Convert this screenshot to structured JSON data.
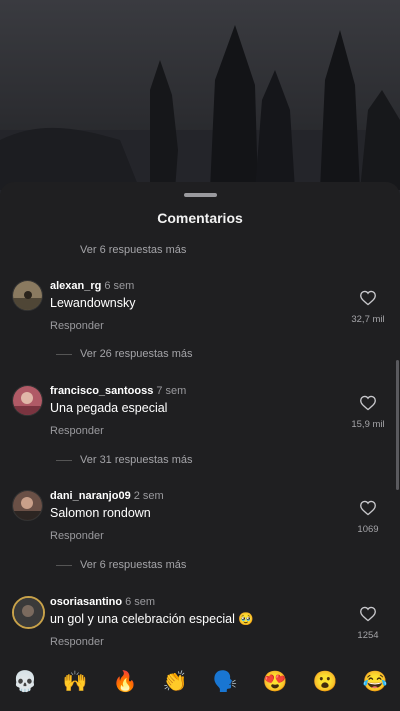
{
  "sheet": {
    "title": "Comentarios"
  },
  "more_replies_top": "Ver 6 respuestas más",
  "comments": [
    {
      "user": "alexan_rg",
      "time": "6 sem",
      "text": "Lewandownsky",
      "reply": "Responder",
      "likes": "32,7 mil",
      "more_replies": "Ver 26 respuestas más",
      "avatar_color": "#8a7a60"
    },
    {
      "user": "francisco_santooss",
      "time": "7 sem",
      "text": "Una pegada especial",
      "reply": "Responder",
      "likes": "15,9 mil",
      "more_replies": "Ver 31 respuestas más",
      "avatar_color": "#b05a66"
    },
    {
      "user": "dani_naranjo09",
      "time": "2 sem",
      "text": "Salomon rondown",
      "reply": "Responder",
      "likes": "1069",
      "more_replies": "Ver 6 respuestas más",
      "avatar_color": "#6a5046"
    },
    {
      "user": "osoriasantino",
      "time": "6 sem",
      "text": "un gol y una celebración especial 🥹",
      "reply": "Responder",
      "likes": "1254",
      "avatar_color": "#3a3a3a"
    }
  ],
  "emojis": [
    "💀",
    "🙌",
    "🔥",
    "👏",
    "🗣️",
    "😍",
    "😮",
    "😂"
  ]
}
